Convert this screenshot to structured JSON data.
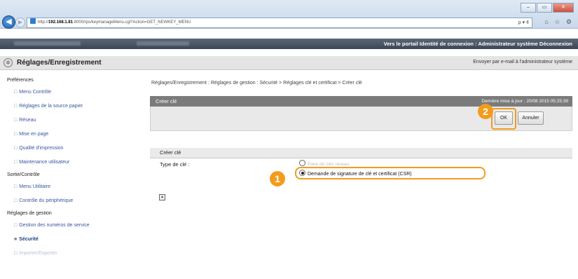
{
  "browser": {
    "window_buttons": [
      "–",
      "▭",
      "✕"
    ],
    "url_prefix": "http://",
    "url_host": "192.168.1.81",
    "url_rest": ":8000/rps/keymanageMenu.cgi?Action=GET_NEWKEY_MENU",
    "addr_controls": "ρ ▾ ¢",
    "toolbar_icons": "⌂ ☆ ⚙"
  },
  "topbar": {
    "links": "Vers le portail  Identité de connexion : Administrateur système  Déconnexion"
  },
  "header": {
    "title": "Réglages/Enregistrement",
    "mail_link": "Envoyer par e-mail à l'administrateur système"
  },
  "sidebar": {
    "sections": [
      {
        "title": "Préférences",
        "items": [
          "Menu Contrôle",
          "Réglages de la source papier",
          "Réseau",
          "Mise en page",
          "Qualité d'impression",
          "Maintenance utilisateur"
        ]
      },
      {
        "title": "Sortie/Contrôle",
        "items": [
          "Menu Utilitaire",
          "Contrôle du périphérique"
        ]
      },
      {
        "title": "Réglages de gestion",
        "items": [
          "Gestion des numéros de service",
          "Sécurité",
          "Importer/Exporter"
        ]
      }
    ]
  },
  "breadcrumb": "Réglages/Enregistrement : Réglages de gestion : Sécurité > Réglages clé et certificat > Créer clé",
  "panel": {
    "title": "Créer clé",
    "last_update": "Dernière mise à jour : 20/08 2015 05:25:39",
    "ok_label": "OK",
    "cancel_label": "Annuler"
  },
  "section": {
    "title": "Créer clé",
    "key_type_label": "Type de clé :",
    "option1": "Paire de clés réseau",
    "option2": "Demande de signature de clé et certificat (CSR)"
  },
  "callouts": {
    "one": "1",
    "two": "2"
  },
  "back_to_top": "▲"
}
